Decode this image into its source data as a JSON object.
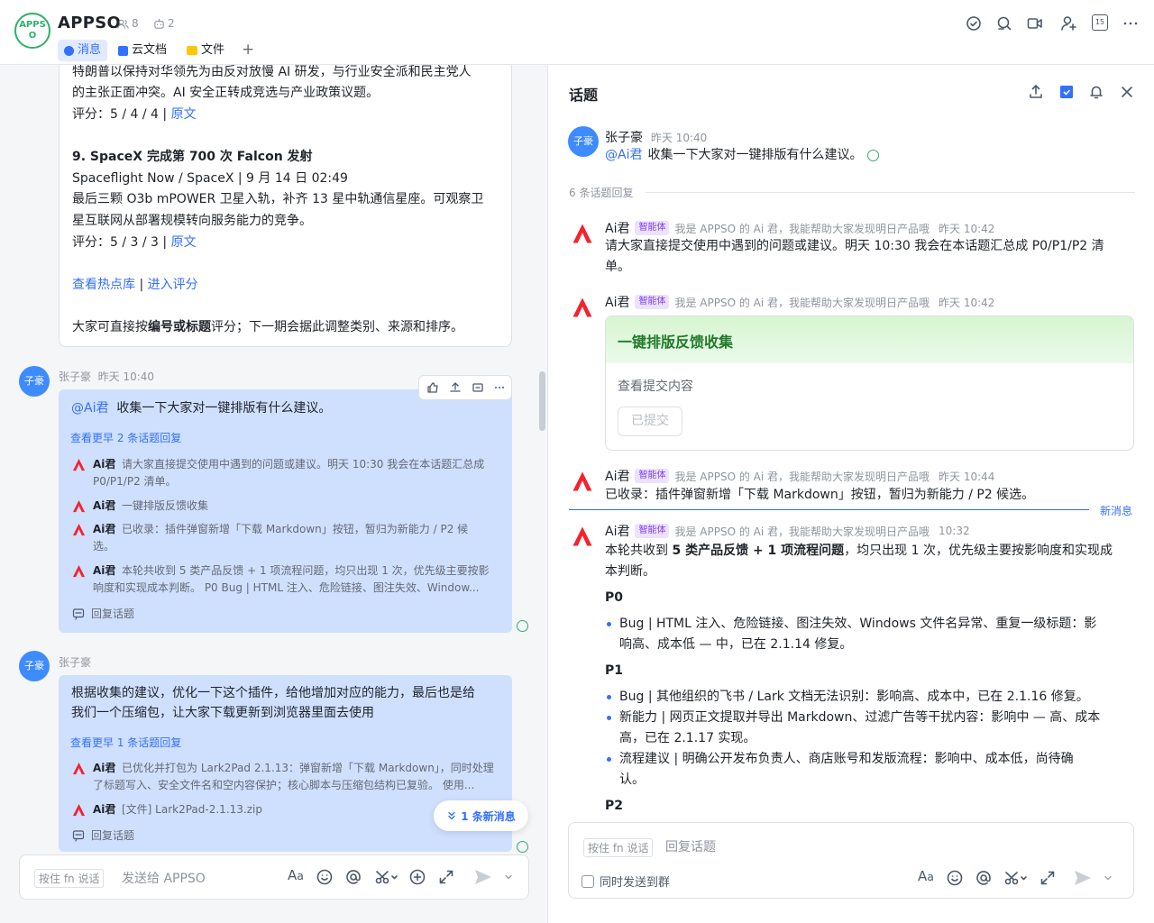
{
  "header": {
    "logo_text": "APPSO",
    "title": "APPSO",
    "member_count": "8",
    "bot_count": "2",
    "tabs": [
      {
        "label": "消息",
        "icon": "chat-icon",
        "active": true
      },
      {
        "label": "云文档",
        "icon": "doc-icon"
      },
      {
        "label": "文件",
        "icon": "folder-icon"
      }
    ],
    "add_tab": "+",
    "calendar_day": "15"
  },
  "left": {
    "top_card": {
      "line1": "特朗普以保持对华领先为由反对放慢 AI 研发，与行业安全派和民主党人",
      "line2": "的主张正面冲突。AI 安全正转成竞选与产业政策议题。",
      "score8_label": "评分：",
      "score8": "5 / 4 / 4",
      "source_link": "原文",
      "item9_title": "9. SpaceX 完成第 700 次 Falcon 发射",
      "item9_meta": "Spaceflight Now / SpaceX | 9 月 14 日 02:49",
      "item9_l1": "最后三颗 O3b mPOWER 卫星入轨，补齐 13 星中轨通信星座。可观察卫",
      "item9_l2": "星互联网从部署规模转向服务能力的竞争。",
      "score9_label": "评分：",
      "score9": "5 / 3 / 3",
      "hot_link": "查看热点库",
      "eval_link": "进入评分",
      "footer_pre": "大家可直接按",
      "footer_bold": "编号或标题",
      "footer_post": "评分；下一期会据此调整类别、来源和排序。"
    },
    "msg1": {
      "avatar": "子豪",
      "sender": "张子豪",
      "time": "昨天 10:40",
      "mention": "@Ai君",
      "text": "收集一下大家对一键排版有什么建议。",
      "earlier": "查看更早 2 条话题回复",
      "replies": [
        {
          "name": "Ai君",
          "lines": [
            "请大家直接提交使用中遇到的问题或建议。明天 10:30 我会在本话题汇总成",
            "P0/P1/P2 清单。"
          ]
        },
        {
          "name": "Ai君",
          "lines": [
            "一键排版反馈收集"
          ]
        },
        {
          "name": "Ai君",
          "lines": [
            "已收录：插件弹窗新增「下载 Markdown」按钮，暂归为新能力 / P2 候",
            "选。"
          ]
        },
        {
          "name": "Ai君",
          "lines": [
            "本轮共收到 5 类产品反馈 + 1 项流程问题，均只出现 1 次，优先级主要按影",
            "响度和实现成本判断。 P0 Bug | HTML 注入、危险链接、图注失效、Window..."
          ]
        }
      ],
      "reply_topic": "回复话题"
    },
    "msg2": {
      "avatar": "子豪",
      "sender": "张子豪",
      "line1": "根据收集的建议，优化一下这个插件，给他增加对应的能力，最后也是给",
      "line2": "我们一个压缩包，让大家下载更新到浏览器里面去使用",
      "earlier": "查看更早 1 条话题回复",
      "replies": [
        {
          "name": "Ai君",
          "lines": [
            "已优化并打包为 Lark2Pad 2.1.13：弹窗新增「下载 Markdown」，同时处理",
            "了标题写入、安全文件名和空内容保护；核心脚本与压缩包结构已复验。 使用..."
          ]
        },
        {
          "name": "Ai君",
          "lines": [
            "[文件] Lark2Pad-2.1.13.zip"
          ]
        }
      ],
      "reply_topic": "回复话题"
    },
    "new_msg": "1 条新消息",
    "composer": {
      "hint": "按住 fn 说话",
      "placeholder": "发送给 APPSO"
    }
  },
  "right": {
    "title": "话题",
    "root": {
      "avatar": "子豪",
      "sender": "张子豪",
      "time": "昨天 10:40",
      "mention": "@Ai君",
      "text": "收集一下大家对一键排版有什么建议。"
    },
    "reply_count": "6 条话题回复",
    "bot_badge": "智能体",
    "bot_desc": "我是 APPSO 的 Ai 君，我能帮助大家发现明日产品哦",
    "r1": {
      "name": "Ai君",
      "time": "昨天 10:42",
      "line1": "请大家直接提交使用中遇到的问题或建议。明天 10:30 我会在本话题汇总成 P0/P1/P2 清",
      "line2": "单。"
    },
    "r2": {
      "name": "Ai君",
      "time": "昨天 10:42",
      "card_title": "一键排版反馈收集",
      "card_label": "查看提交内容",
      "card_button": "已提交"
    },
    "r3": {
      "name": "Ai君",
      "time": "昨天 10:44",
      "text": "已收录：插件弹窗新增「下载 Markdown」按钮，暂归为新能力 / P2 候选。"
    },
    "new_divider": "新消息",
    "r4": {
      "name": "Ai君",
      "time": "10:32",
      "intro_a": "本轮共收到 ",
      "intro_b": "5 类产品反馈 + 1 项流程问题",
      "intro_c": "，均只出现 1 次，优先级主要按影响度和实现成",
      "intro_d": "本判断。",
      "p0": "P0",
      "p0_b1_l1": "Bug | HTML 注入、危险链接、图注失效、Windows 文件名异常、重复一级标题：影",
      "p0_b1_l2": "响高、成本低 — 中，已在 2.1.14 修复。",
      "p1": "P1",
      "p1_b1": "Bug | 其他组织的飞书 / Lark 文档无法识别：影响高、成本中，已在 2.1.16 修复。",
      "p1_b2_l1": "新能力 | 网页正文提取并导出 Markdown、过滤广告等干扰内容：影响中 — 高、成本",
      "p1_b2_l2": "高，已在 2.1.17 实现。",
      "p1_b3_l1": "流程建议 | 明确公开发布负责人、商店账号和发版流程：影响中、成本低，尚待确",
      "p1_b3_l2": "认。",
      "p2": "P2"
    },
    "composer": {
      "hint": "按住 fn 说话",
      "placeholder": "回复话题",
      "checkbox_label": "同时发送到群"
    }
  },
  "colors": {
    "accent": "#3370ff",
    "bubble": "#cfe0ff",
    "bot_badge": "#7f3bf5",
    "card_header": "#e4f7df"
  }
}
